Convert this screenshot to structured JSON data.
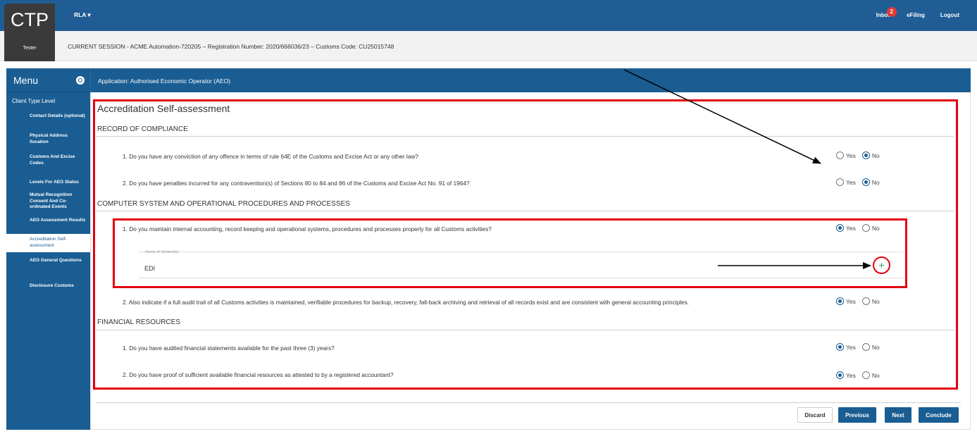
{
  "header": {
    "logo": "CTP",
    "user": "Tester",
    "menu": "RLA",
    "links": [
      "Inbox",
      "eFiling",
      "Logout"
    ],
    "inbox_badge": "2"
  },
  "session": {
    "text": "CURRENT SESSION - ACME Automation-720205 – Registration Number: 2020/666036/23 – Customs Code: CU25015748"
  },
  "sidebar": {
    "title": "Menu",
    "section": "Client Type Level",
    "items": [
      {
        "label": "Contact Details (optional)",
        "active": false
      },
      {
        "label": "Physical Address /location",
        "active": false
      },
      {
        "label": "Customs And Excise Codes",
        "active": false
      },
      {
        "label": "Levels For AEO Status",
        "active": false
      },
      {
        "label": "Mutual Recognition Consent And Co-ordinated Events",
        "active": false
      },
      {
        "label": "AEO Assessment Results",
        "active": false
      },
      {
        "label": "Accreditation Self-assessment",
        "active": true
      },
      {
        "label": "AEO General Questions",
        "active": false
      },
      {
        "label": "Disclosure Customs",
        "active": false
      }
    ]
  },
  "app_bar": "Application: Authorised Economic Operator (AEO)",
  "page_title": "Accreditation Self-assessment",
  "sections": [
    {
      "title": "RECORD OF COMPLIANCE",
      "questions": [
        {
          "text": "1. Do you have any conviction of any offence in terms of rule 64E of the Customs and Excise Act or any other law?",
          "answer": "No"
        },
        {
          "text": "2. Do you have penalties incurred for any contravention(s) of Sections 80 to 84 and 86 of the Customs and Excise Act No. 91 of 1964?",
          "answer": "No"
        }
      ]
    },
    {
      "title": "COMPUTER SYSTEM AND OPERATIONAL PROCEDURES AND PROCESSES",
      "questions": [
        {
          "text": "1. Do you maintain internal accounting, record keeping and operational systems, procedures and processes properly for all Customs activities?",
          "answer": "Yes"
        },
        {
          "text": "2. Also indicate if a full audit trail of all Customs activities is maintained, verifiable procedures for backup, recovery, fall-back archiving and retrieval of all records exist and are consistent with general accounting principles.",
          "answer": "Yes"
        }
      ]
    },
    {
      "title": "FINANCIAL RESOURCES",
      "questions": [
        {
          "text": "1. Do you have audited financial statements available for the past three (3) years?",
          "answer": "Yes"
        },
        {
          "text": "2. Do you have proof of sufficient available financial resources as attested to by a registered accountant?",
          "answer": "Yes"
        }
      ]
    }
  ],
  "radio_labels": {
    "yes": "Yes",
    "no": "No"
  },
  "system_field": {
    "label": "Name of System(s)",
    "value": "EDI",
    "add_icon": "+"
  },
  "buttons": {
    "discard": "Discard",
    "previous": "Previous",
    "next": "Next",
    "conclude": "Conclude"
  },
  "colors": {
    "primary": "#1a5d92",
    "highlight": "#e3000f",
    "add": "#3aa24a"
  }
}
